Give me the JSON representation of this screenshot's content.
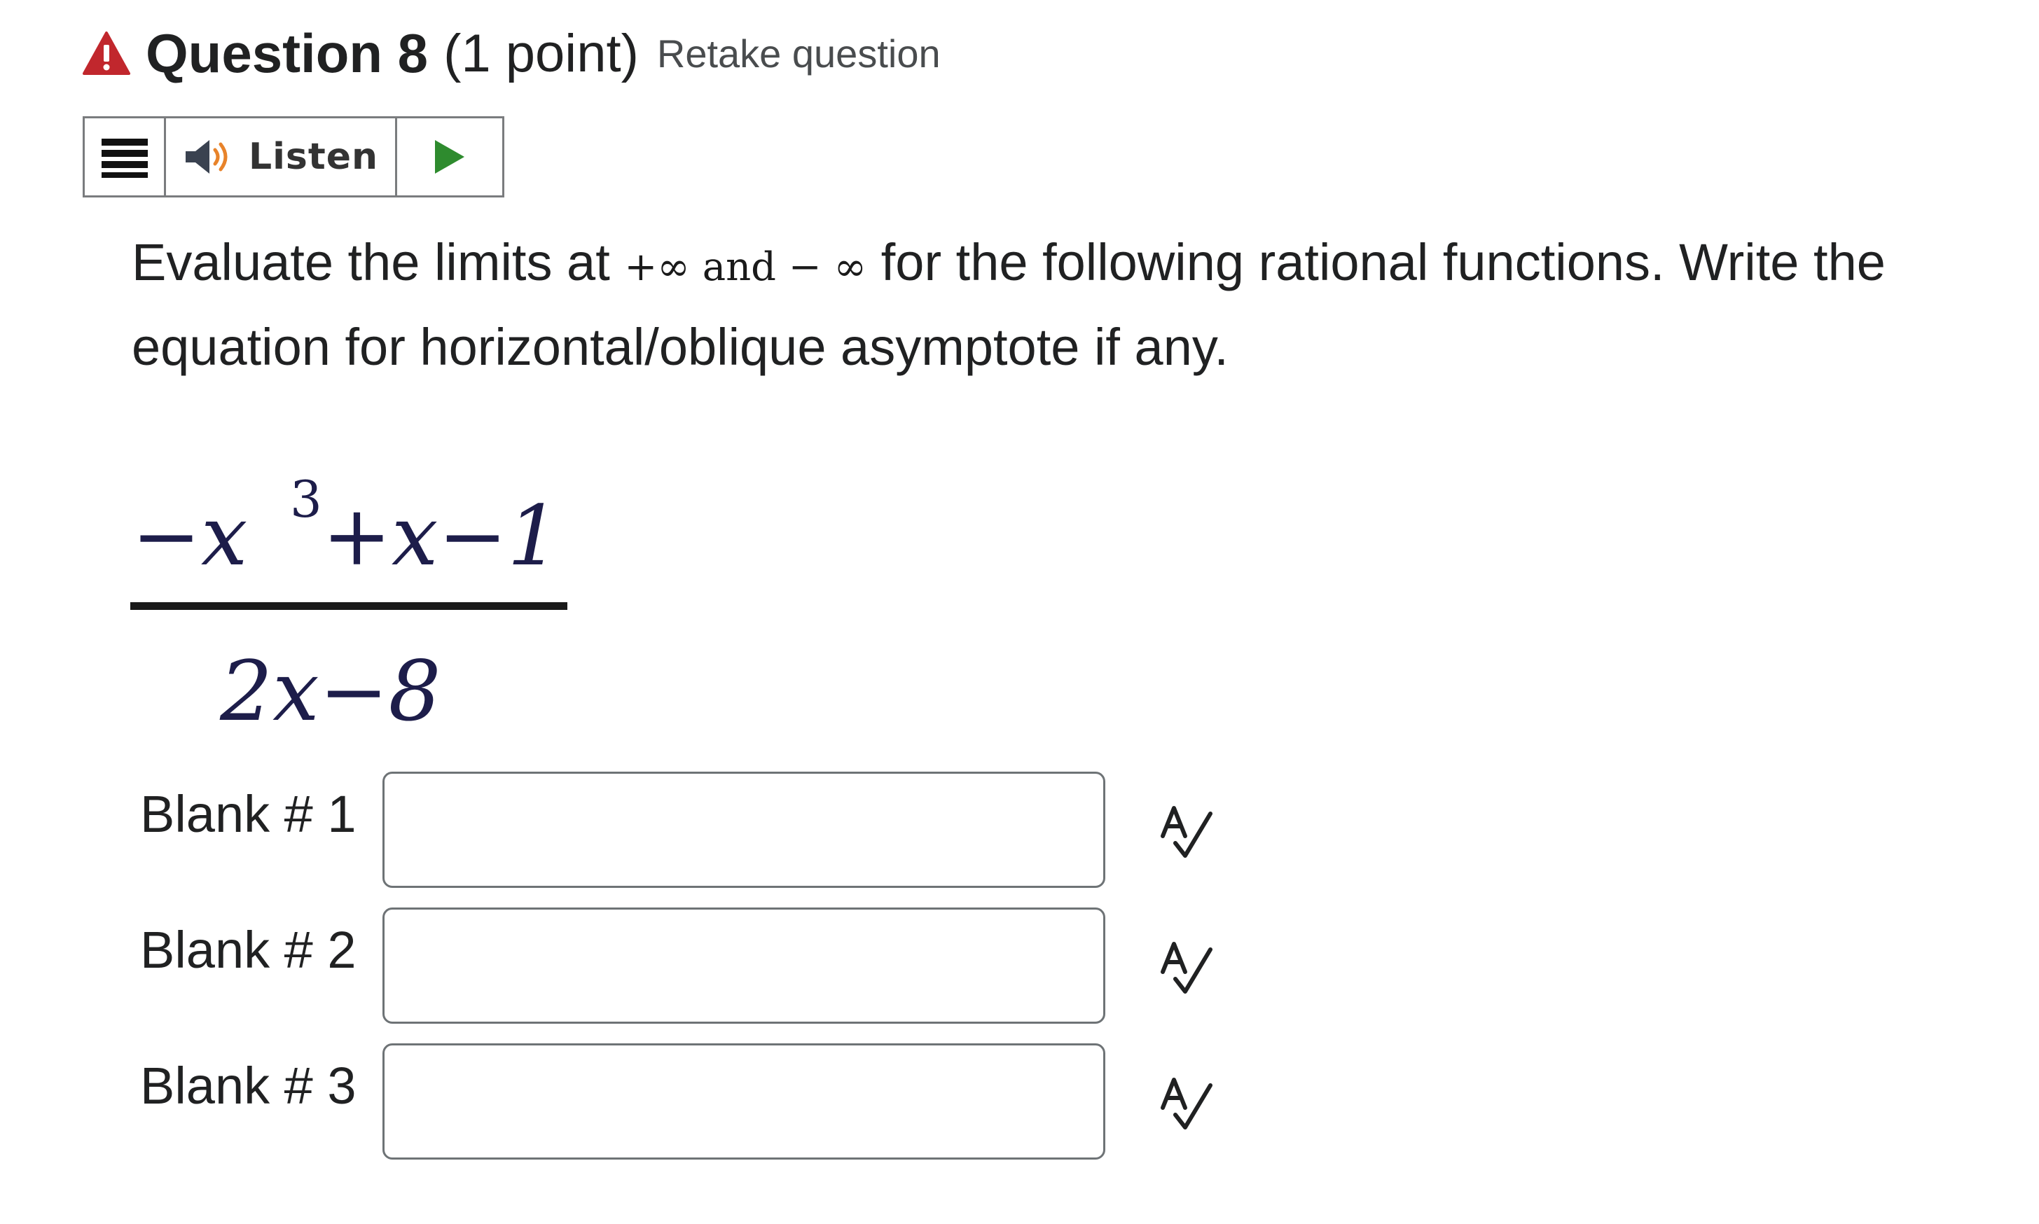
{
  "question": {
    "title": "Question 8",
    "points": "(1 point)",
    "retake_label": "Retake question",
    "warning_icon": "warning-triangle-icon"
  },
  "toolbar": {
    "menu_icon": "menu-icon",
    "speaker_icon": "speaker-icon",
    "listen_label": "Listen",
    "play_icon": "play-icon"
  },
  "prompt": {
    "text_before": "Evaluate the limits at ",
    "inline_math": "+∞ and − ∞",
    "text_after": " for the following rational functions. Write the equation for horizontal/oblique asymptote if any."
  },
  "formula": {
    "numerator_lead": "−x",
    "numerator_exp": "3",
    "numerator_rest": "+x−1",
    "denominator": "2x−8"
  },
  "blanks": [
    {
      "label": "Blank # 1",
      "value": "",
      "spellcheck_icon": "spellcheck-icon"
    },
    {
      "label": "Blank # 2",
      "value": "",
      "spellcheck_icon": "spellcheck-icon"
    },
    {
      "label": "Blank # 3",
      "value": "",
      "spellcheck_icon": "spellcheck-icon"
    }
  ],
  "colors": {
    "warning_red": "#c1272d",
    "play_green": "#2e8b2e",
    "speaker_orange": "#e8832a",
    "math_navy": "#1d1d4a"
  }
}
